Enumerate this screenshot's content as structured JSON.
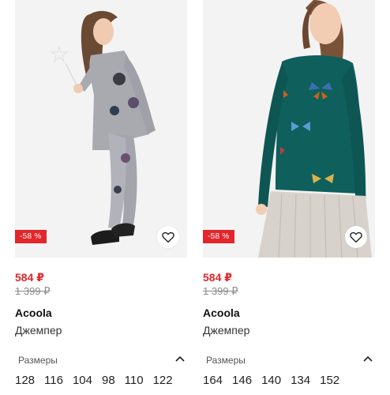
{
  "products": [
    {
      "discount": "-58 %",
      "price": "584 ₽",
      "old_price": "1 399 ₽",
      "brand": "Acoola",
      "type": "Джемпер",
      "sizes_label": "Размеры",
      "sizes": [
        "128",
        "116",
        "104",
        "98",
        "110",
        "122"
      ],
      "colors": {
        "photo_bg": "#f3f3f3",
        "garment": "#a9a9b0"
      }
    },
    {
      "discount": "-58 %",
      "price": "584 ₽",
      "old_price": "1 399 ₽",
      "brand": "Acoola",
      "type": "Джемпер",
      "sizes_label": "Размеры",
      "sizes": [
        "164",
        "146",
        "140",
        "134",
        "152"
      ],
      "colors": {
        "photo_bg": "#f3f3f3",
        "garment": "#0f5f5c"
      }
    }
  ],
  "theme": {
    "accent": "#e3262b",
    "muted": "#8a8a8a"
  },
  "icons": {
    "favorite": "heart-icon",
    "collapse": "chevron-up-icon"
  }
}
